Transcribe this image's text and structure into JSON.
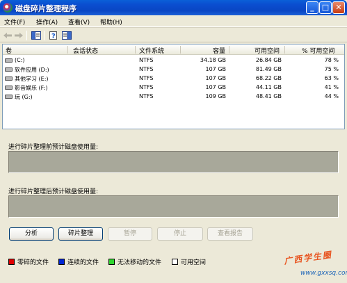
{
  "window": {
    "title": "磁盘碎片整理程序"
  },
  "menu": [
    "文件(F)",
    "操作(A)",
    "查看(V)",
    "帮助(H)"
  ],
  "table": {
    "headers": [
      "卷",
      "会话状态",
      "文件系统",
      "容量",
      "可用空间",
      "% 可用空间"
    ],
    "rows": [
      {
        "volume": "(C:)",
        "status": "",
        "fs": "NTFS",
        "capacity": "34.18 GB",
        "free": "26.84 GB",
        "pct": "78 %"
      },
      {
        "volume": "软件应用 (D:)",
        "status": "",
        "fs": "NTFS",
        "capacity": "107 GB",
        "free": "81.49 GB",
        "pct": "75 %"
      },
      {
        "volume": "其他学习 (E:)",
        "status": "",
        "fs": "NTFS",
        "capacity": "107 GB",
        "free": "68.22 GB",
        "pct": "63 %"
      },
      {
        "volume": "影音娱乐 (F:)",
        "status": "",
        "fs": "NTFS",
        "capacity": "107 GB",
        "free": "44.11 GB",
        "pct": "41 %"
      },
      {
        "volume": "玩 (G:)",
        "status": "",
        "fs": "NTFS",
        "capacity": "109 GB",
        "free": "48.41 GB",
        "pct": "44 %"
      }
    ]
  },
  "panels": {
    "before_label": "进行碎片整理前预计磁盘使用量:",
    "after_label": "进行碎片整理后预计磁盘使用量:"
  },
  "buttons": {
    "analyze": "分析",
    "defrag": "碎片整理",
    "pause": "暂停",
    "stop": "停止",
    "report": "查看报告"
  },
  "legend": [
    {
      "label": "零碎的文件",
      "color": "#e00000"
    },
    {
      "label": "连续的文件",
      "color": "#0026d4"
    },
    {
      "label": "无法移动的文件",
      "color": "#2fd62f"
    },
    {
      "label": "可用空间",
      "color": "#ffffff"
    }
  ],
  "watermark": {
    "text": "广西学生圈",
    "url": "www.gxxsq.com"
  }
}
